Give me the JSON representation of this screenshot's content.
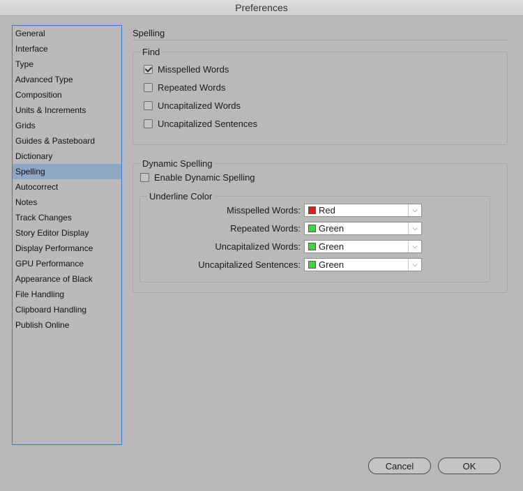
{
  "window": {
    "title": "Preferences"
  },
  "sidebar": {
    "items": [
      {
        "label": "General"
      },
      {
        "label": "Interface"
      },
      {
        "label": "Type"
      },
      {
        "label": "Advanced Type"
      },
      {
        "label": "Composition"
      },
      {
        "label": "Units & Increments"
      },
      {
        "label": "Grids"
      },
      {
        "label": "Guides & Pasteboard"
      },
      {
        "label": "Dictionary"
      },
      {
        "label": "Spelling"
      },
      {
        "label": "Autocorrect"
      },
      {
        "label": "Notes"
      },
      {
        "label": "Track Changes"
      },
      {
        "label": "Story Editor Display"
      },
      {
        "label": "Display Performance"
      },
      {
        "label": "GPU Performance"
      },
      {
        "label": "Appearance of Black"
      },
      {
        "label": "File Handling"
      },
      {
        "label": "Clipboard Handling"
      },
      {
        "label": "Publish Online"
      }
    ],
    "selected": "Spelling"
  },
  "main": {
    "title": "Spelling",
    "find": {
      "legend": "Find",
      "options": [
        {
          "label": "Misspelled Words",
          "checked": true
        },
        {
          "label": "Repeated Words",
          "checked": false
        },
        {
          "label": "Uncapitalized Words",
          "checked": false
        },
        {
          "label": "Uncapitalized Sentences",
          "checked": false
        }
      ]
    },
    "dynamic": {
      "legend": "Dynamic Spelling",
      "enable_label": "Enable Dynamic Spelling",
      "enabled": false,
      "underline": {
        "legend": "Underline Color",
        "rows": [
          {
            "label": "Misspelled Words:",
            "value": "Red",
            "color": "#e8191b"
          },
          {
            "label": "Repeated Words:",
            "value": "Green",
            "color": "#3ed63b"
          },
          {
            "label": "Uncapitalized Words:",
            "value": "Green",
            "color": "#3ed63b"
          },
          {
            "label": "Uncapitalized Sentences:",
            "value": "Green",
            "color": "#3ed63b"
          }
        ]
      }
    }
  },
  "buttons": {
    "cancel": "Cancel",
    "ok": "OK"
  }
}
